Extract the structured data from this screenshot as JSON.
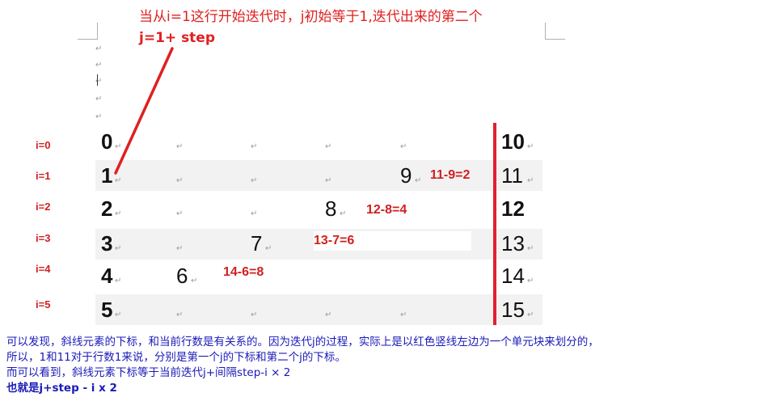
{
  "annotation": {
    "line1": "当从i=1这行开始迭代时，j初始等于1,迭代出来的第二个",
    "line2": "j=1+ step"
  },
  "row_labels": [
    "i=0",
    "i=1",
    "i=2",
    "i=3",
    "i=4",
    "i=5"
  ],
  "left_column": [
    "0",
    "1",
    "2",
    "3",
    "4",
    "5"
  ],
  "right_column": [
    "10",
    "11",
    "12",
    "13",
    "14",
    "15"
  ],
  "diagonal": [
    "9",
    "8",
    "7",
    "6"
  ],
  "calcs": [
    "11-9=2",
    "12-8=4",
    "13-7=6",
    "14-6=8"
  ],
  "paragraph_mark": "↵",
  "explanation": [
    "可以发现，斜线元素的下标，和当前行数是有关系的。因为迭代j的过程，实际上是以红色竖线左边为一个单元块来划分的，",
    "所以，1和11对于行数1来说，分别是第一个j的下标和第二个j的下标。",
    "而可以看到，斜线元素下标等于当前迭代j+间隔step-i × 2",
    "也就是j+step - i x 2"
  ],
  "colors": {
    "annotation": "#e02020",
    "divider": "#e02030",
    "explanation": "#1a1ab8",
    "row_shade": "#f2f2f2"
  }
}
